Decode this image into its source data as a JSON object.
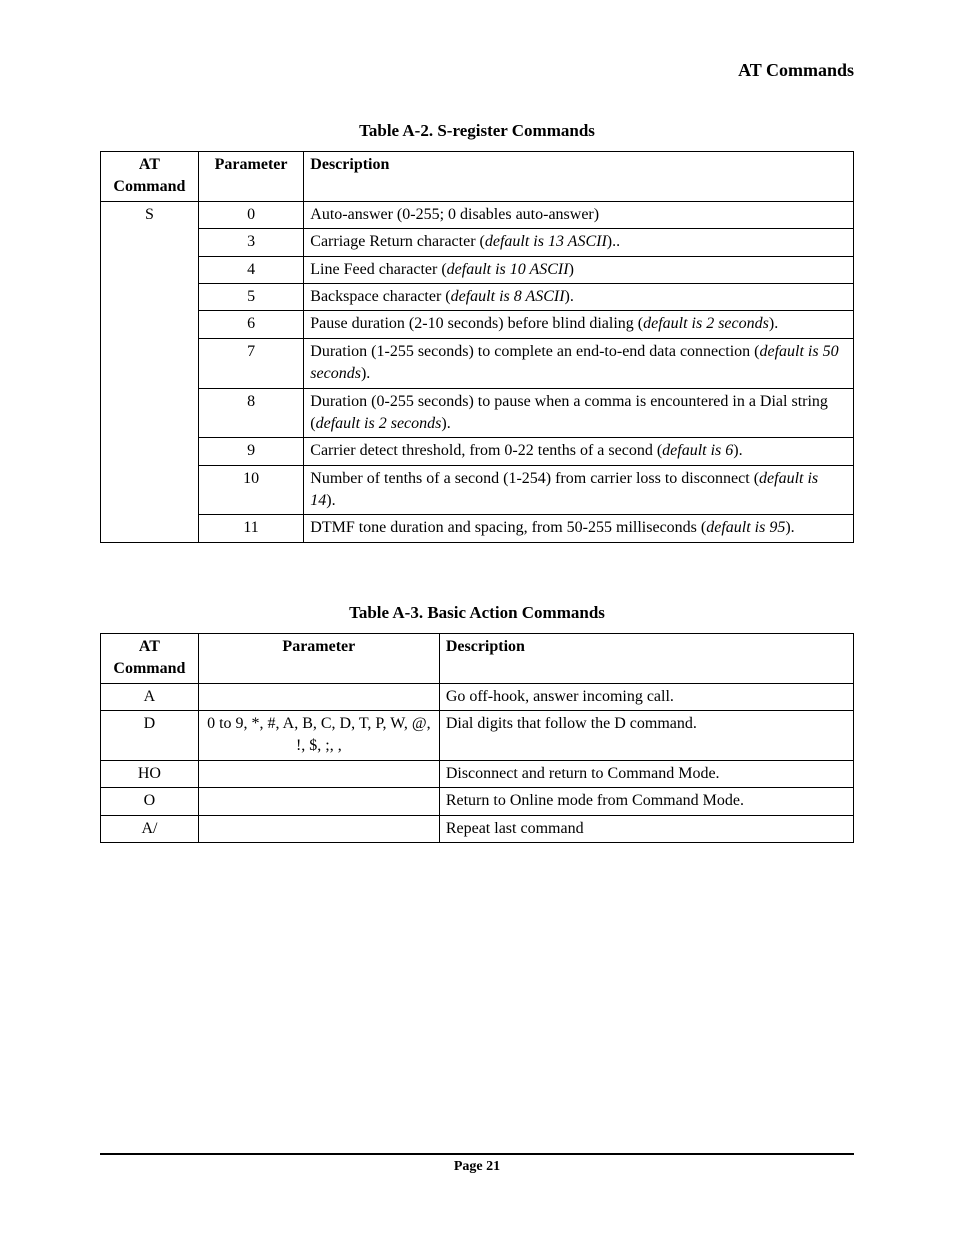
{
  "header": "AT Commands",
  "footer": "Page 21",
  "tableA2": {
    "caption": "Table A-2. S-register Commands",
    "headers": {
      "cmd": "AT Command",
      "param": "Parameter",
      "desc": "Description"
    },
    "cmd": "S",
    "rows": [
      {
        "param": "0",
        "desc_plain": "Auto-answer (0-255; 0 disables auto-answer)",
        "desc_italic": ""
      },
      {
        "param": "3",
        "desc_plain": "Carriage Return character (",
        "desc_italic": "default is 13 ASCII",
        "desc_tail": ").."
      },
      {
        "param": "4",
        "desc_plain": "Line Feed character (",
        "desc_italic": "default is 10 ASCII",
        "desc_tail": ")"
      },
      {
        "param": "5",
        "desc_plain": "Backspace character (",
        "desc_italic": "default is 8 ASCII",
        "desc_tail": ")."
      },
      {
        "param": "6",
        "desc_plain": "Pause duration (2-10 seconds) before blind dialing (",
        "desc_italic": "default is 2 seconds",
        "desc_tail": ")."
      },
      {
        "param": "7",
        "desc_plain": "Duration (1-255 seconds) to complete an end-to-end data connection (",
        "desc_italic": "default is 50 seconds",
        "desc_tail": ")."
      },
      {
        "param": "8",
        "desc_plain": "Duration (0-255 seconds) to pause when a comma is encountered in a Dial string (",
        "desc_italic": "default is 2 seconds",
        "desc_tail": ")."
      },
      {
        "param": "9",
        "desc_plain": "Carrier detect threshold, from 0-22 tenths of a second (",
        "desc_italic": "default is 6",
        "desc_tail": ")."
      },
      {
        "param": "10",
        "desc_plain": "Number of tenths of a second (1-254) from carrier loss to disconnect (",
        "desc_italic": "default is 14",
        "desc_tail": ")."
      },
      {
        "param": "11",
        "desc_plain": "DTMF tone duration and spacing, from 50-255 milliseconds (",
        "desc_italic": "default is 95",
        "desc_tail": ")."
      }
    ]
  },
  "tableA3": {
    "caption": "Table A-3. Basic Action Commands",
    "headers": {
      "cmd": "AT Command",
      "param": "Parameter",
      "desc": "Description"
    },
    "rows": [
      {
        "cmd": "A",
        "param": "",
        "desc": "Go off-hook, answer incoming call."
      },
      {
        "cmd": "D",
        "param": "0 to 9, *, #, A, B, C, D, T,  P,  W,  @,  !,  $, ;,  ,",
        "desc": "Dial digits that follow the D command."
      },
      {
        "cmd": "HO",
        "param": "",
        "desc": "Disconnect and return to Command Mode."
      },
      {
        "cmd": "O",
        "param": "",
        "desc": "Return to Online mode from Command Mode."
      },
      {
        "cmd": "A/",
        "param": "",
        "desc": "Repeat last command"
      }
    ]
  }
}
